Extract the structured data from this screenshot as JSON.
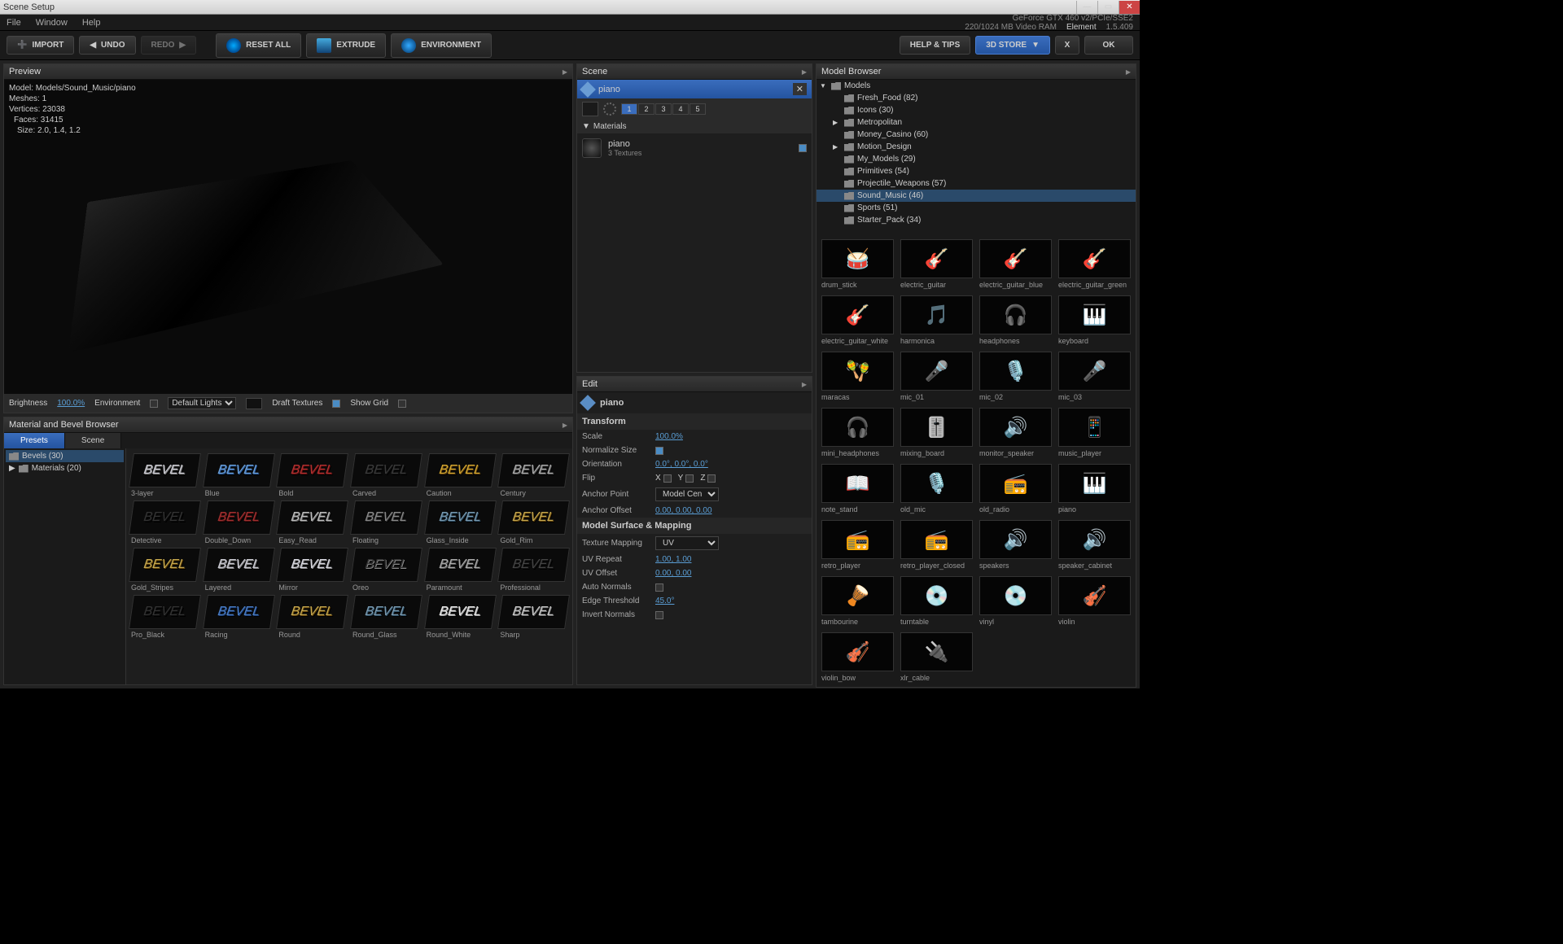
{
  "window_title": "Scene Setup",
  "menus": {
    "file": "File",
    "window": "Window",
    "help": "Help"
  },
  "gpu": {
    "line1": "GeForce GTX 460 v2/PCIe/SSE2",
    "line2": "220/1024 MB Video RAM"
  },
  "app": {
    "name": "Element",
    "version": "1.5.409"
  },
  "toolbar": {
    "import": "IMPORT",
    "undo": "UNDO",
    "redo": "REDO",
    "reset_all": "RESET ALL",
    "extrude": "EXTRUDE",
    "environment": "ENVIRONMENT",
    "help_tips": "HELP & TIPS",
    "store": "3D STORE",
    "x": "X",
    "ok": "OK"
  },
  "preview": {
    "title": "Preview",
    "stats": {
      "model_label": "Model:",
      "model": "Models/Sound_Music/piano",
      "meshes_label": "Meshes:",
      "meshes": "1",
      "vertices_label": "Vertices:",
      "vertices": "23038",
      "faces_label": "Faces:",
      "faces": "31415",
      "size_label": "Size:",
      "size": "2.0, 1.4, 1.2"
    },
    "opts": {
      "brightness": "Brightness",
      "brightness_val": "100.0%",
      "environment": "Environment",
      "lights": "Default Lights",
      "draft_textures": "Draft Textures",
      "show_grid": "Show Grid"
    }
  },
  "material_browser": {
    "title": "Material and Bevel Browser",
    "tabs": {
      "presets": "Presets",
      "scene": "Scene"
    },
    "tree": {
      "bevels": "Bevels (30)",
      "materials": "Materials (20)"
    },
    "bevels": [
      {
        "name": "3-layer",
        "c1": "#c8c8d0",
        "c2": "#888"
      },
      {
        "name": "Blue",
        "c1": "#6a9dd4",
        "c2": "#2a5a9a"
      },
      {
        "name": "Bold",
        "c1": "#b03030",
        "c2": "#601010"
      },
      {
        "name": "Carved",
        "c1": "#3a3a3a",
        "c2": "#111"
      },
      {
        "name": "Caution",
        "c1": "#d4a830",
        "c2": "#604010"
      },
      {
        "name": "Century",
        "c1": "#aaa",
        "c2": "#555"
      },
      {
        "name": "Detective",
        "c1": "#333",
        "c2": "#0a0a0a"
      },
      {
        "name": "Double_Down",
        "c1": "#a03030",
        "c2": "#501010"
      },
      {
        "name": "Easy_Read",
        "c1": "#bbb",
        "c2": "#666"
      },
      {
        "name": "Floating",
        "c1": "#888",
        "c2": "#333"
      },
      {
        "name": "Glass_Inside",
        "c1": "#7a9ab0",
        "c2": "#2a4a60"
      },
      {
        "name": "Gold_Rim",
        "c1": "#c4a850",
        "c2": "#604008"
      },
      {
        "name": "Gold_Stripes",
        "c1": "#c4a850",
        "c2": "#604008"
      },
      {
        "name": "Layered",
        "c1": "#c8c8d0",
        "c2": "#888"
      },
      {
        "name": "Mirror",
        "c1": "#d8d8e0",
        "c2": "#888"
      },
      {
        "name": "Oreo",
        "c1": "#333",
        "c2": "#888"
      },
      {
        "name": "Paramount",
        "c1": "#aaa",
        "c2": "#555"
      },
      {
        "name": "Professional",
        "c1": "#444",
        "c2": "#111"
      },
      {
        "name": "Pro_Black",
        "c1": "#333",
        "c2": "#0a0a0a"
      },
      {
        "name": "Racing",
        "c1": "#4a7dc4",
        "c2": "#1a3a70"
      },
      {
        "name": "Round",
        "c1": "#c4a850",
        "c2": "#604008"
      },
      {
        "name": "Round_Glass",
        "c1": "#7a9ab0",
        "c2": "#2a4a60"
      },
      {
        "name": "Round_White",
        "c1": "#e8e8e8",
        "c2": "#999"
      },
      {
        "name": "Sharp",
        "c1": "#c8c8c8",
        "c2": "#666"
      }
    ]
  },
  "scene": {
    "title": "Scene",
    "obj": "piano",
    "groups": [
      "1",
      "2",
      "3",
      "4",
      "5"
    ],
    "materials_header": "Materials",
    "mat_name": "piano",
    "mat_sub": "3 Textures"
  },
  "edit": {
    "title": "Edit",
    "obj": "piano",
    "transform": "Transform",
    "props": {
      "scale": {
        "label": "Scale",
        "val": "100.0%"
      },
      "norm_size": {
        "label": "Normalize Size"
      },
      "orient": {
        "label": "Orientation",
        "val": "0.0°, 0.0°, 0.0°"
      },
      "flip": {
        "label": "Flip",
        "x": "X",
        "y": "Y",
        "z": "Z"
      },
      "anchor_pt": {
        "label": "Anchor Point",
        "val": "Model Center"
      },
      "anchor_off": {
        "label": "Anchor Offset",
        "val": "0.00, 0.00, 0.00"
      }
    },
    "mapping": "Model Surface & Mapping",
    "map_props": {
      "tex_map": {
        "label": "Texture Mapping",
        "val": "UV"
      },
      "uv_repeat": {
        "label": "UV Repeat",
        "val": "1.00, 1.00"
      },
      "uv_offset": {
        "label": "UV Offset",
        "val": "0.00, 0.00"
      },
      "auto_norm": {
        "label": "Auto Normals"
      },
      "edge_thresh": {
        "label": "Edge Threshold",
        "val": "45.0°"
      },
      "invert_norm": {
        "label": "Invert Normals"
      }
    }
  },
  "browser": {
    "title": "Model Browser",
    "tree": [
      {
        "name": "Models",
        "depth": 0,
        "arrow": "▼"
      },
      {
        "name": "Fresh_Food (82)",
        "depth": 1
      },
      {
        "name": "Icons (30)",
        "depth": 1
      },
      {
        "name": "Metropolitan",
        "depth": 1,
        "arrow": "▶"
      },
      {
        "name": "Money_Casino (60)",
        "depth": 1
      },
      {
        "name": "Motion_Design",
        "depth": 1,
        "arrow": "▶"
      },
      {
        "name": "My_Models (29)",
        "depth": 1
      },
      {
        "name": "Primitives (54)",
        "depth": 1
      },
      {
        "name": "Projectile_Weapons (57)",
        "depth": 1
      },
      {
        "name": "Sound_Music (46)",
        "depth": 1,
        "selected": true
      },
      {
        "name": "Sports (51)",
        "depth": 1
      },
      {
        "name": "Starter_Pack (34)",
        "depth": 1
      }
    ],
    "models": [
      "drum_stick",
      "electric_guitar",
      "electric_guitar_blue",
      "electric_guitar_green",
      "electric_guitar_white",
      "harmonica",
      "headphones",
      "keyboard",
      "maracas",
      "mic_01",
      "mic_02",
      "mic_03",
      "mini_headphones",
      "mixing_board",
      "monitor_speaker",
      "music_player",
      "note_stand",
      "old_mic",
      "old_radio",
      "piano",
      "retro_player",
      "retro_player_closed",
      "speakers",
      "speaker_cabinet",
      "tambourine",
      "turntable",
      "vinyl",
      "violin",
      "violin_bow",
      "xlr_cable"
    ]
  }
}
